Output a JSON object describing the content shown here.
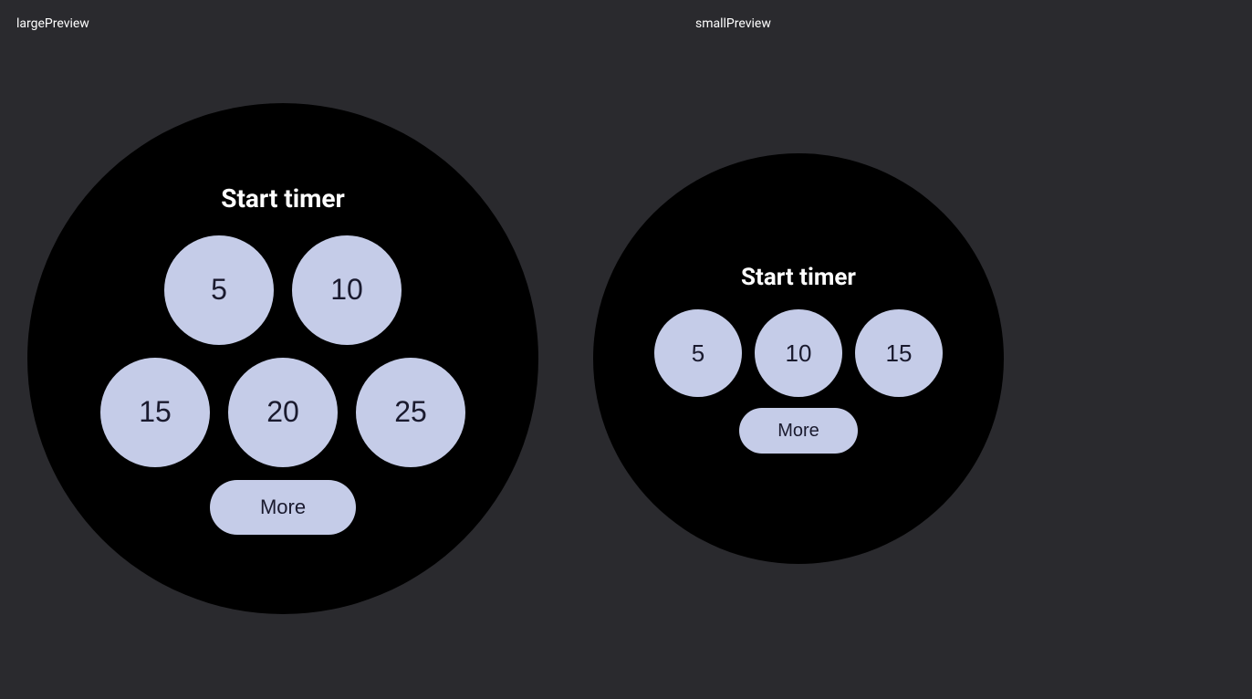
{
  "labels": {
    "large_preview": "largePreview",
    "small_preview": "smallPreview"
  },
  "large_watch": {
    "title": "Start timer",
    "row1": [
      "5",
      "10"
    ],
    "row2": [
      "15",
      "20",
      "25"
    ],
    "more_label": "More"
  },
  "small_watch": {
    "title": "Start timer",
    "row1": [
      "5",
      "10",
      "15"
    ],
    "more_label": "More"
  }
}
